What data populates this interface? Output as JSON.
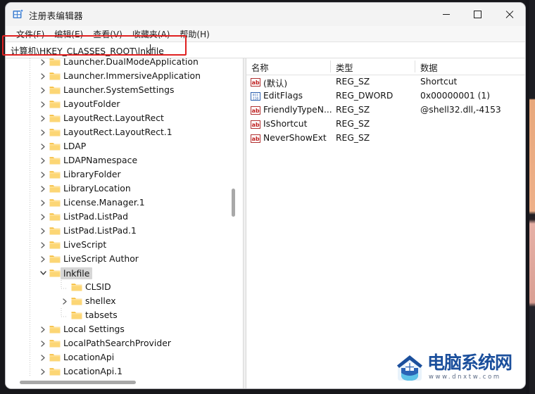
{
  "window": {
    "title": "注册表编辑器",
    "app_icon": "registry-editor-icon",
    "controls": {
      "minimize": "最小化",
      "maximize": "最大化",
      "close": "关闭"
    }
  },
  "menubar": {
    "items": [
      {
        "label": "文件(F)"
      },
      {
        "label": "编辑(E)"
      },
      {
        "label": "查看(V)"
      },
      {
        "label": "收藏夹(A)"
      },
      {
        "label": "帮助(H)"
      }
    ]
  },
  "address_bar": {
    "value": "计算机\\HKEY_CLASSES_ROOT\\lnkfile",
    "placeholder": "计算机\\",
    "highlighted": true,
    "highlight_color": "#e02020"
  },
  "tree": {
    "items": [
      {
        "label": "Launcher.DualModeApplication",
        "indent": 0,
        "expandable": true,
        "expanded": false,
        "selected": false
      },
      {
        "label": "Launcher.ImmersiveApplication",
        "indent": 0,
        "expandable": true,
        "expanded": false,
        "selected": false
      },
      {
        "label": "Launcher.SystemSettings",
        "indent": 0,
        "expandable": true,
        "expanded": false,
        "selected": false
      },
      {
        "label": "LayoutFolder",
        "indent": 0,
        "expandable": true,
        "expanded": false,
        "selected": false
      },
      {
        "label": "LayoutRect.LayoutRect",
        "indent": 0,
        "expandable": true,
        "expanded": false,
        "selected": false
      },
      {
        "label": "LayoutRect.LayoutRect.1",
        "indent": 0,
        "expandable": true,
        "expanded": false,
        "selected": false
      },
      {
        "label": "LDAP",
        "indent": 0,
        "expandable": true,
        "expanded": false,
        "selected": false
      },
      {
        "label": "LDAPNamespace",
        "indent": 0,
        "expandable": true,
        "expanded": false,
        "selected": false
      },
      {
        "label": "LibraryFolder",
        "indent": 0,
        "expandable": true,
        "expanded": false,
        "selected": false
      },
      {
        "label": "LibraryLocation",
        "indent": 0,
        "expandable": true,
        "expanded": false,
        "selected": false
      },
      {
        "label": "License.Manager.1",
        "indent": 0,
        "expandable": true,
        "expanded": false,
        "selected": false
      },
      {
        "label": "ListPad.ListPad",
        "indent": 0,
        "expandable": true,
        "expanded": false,
        "selected": false
      },
      {
        "label": "ListPad.ListPad.1",
        "indent": 0,
        "expandable": true,
        "expanded": false,
        "selected": false
      },
      {
        "label": "LiveScript",
        "indent": 0,
        "expandable": true,
        "expanded": false,
        "selected": false
      },
      {
        "label": "LiveScript Author",
        "indent": 0,
        "expandable": true,
        "expanded": false,
        "selected": false
      },
      {
        "label": "lnkfile",
        "indent": 0,
        "expandable": true,
        "expanded": true,
        "selected": true
      },
      {
        "label": "CLSID",
        "indent": 1,
        "expandable": false,
        "expanded": false,
        "selected": false
      },
      {
        "label": "shellex",
        "indent": 1,
        "expandable": true,
        "expanded": false,
        "selected": false
      },
      {
        "label": "tabsets",
        "indent": 1,
        "expandable": false,
        "expanded": false,
        "selected": false
      },
      {
        "label": "Local Settings",
        "indent": 0,
        "expandable": true,
        "expanded": false,
        "selected": false
      },
      {
        "label": "LocalPathSearchProvider",
        "indent": 0,
        "expandable": true,
        "expanded": false,
        "selected": false
      },
      {
        "label": "LocationApi",
        "indent": 0,
        "expandable": true,
        "expanded": false,
        "selected": false
      },
      {
        "label": "LocationApi.1",
        "indent": 0,
        "expandable": true,
        "expanded": false,
        "selected": false
      }
    ]
  },
  "values_list": {
    "columns": [
      {
        "label": "名称"
      },
      {
        "label": "类型"
      },
      {
        "label": "数据"
      }
    ],
    "rows": [
      {
        "icon": "string-value-icon",
        "name": "(默认)",
        "type": "REG_SZ",
        "data": "Shortcut"
      },
      {
        "icon": "dword-value-icon",
        "name": "EditFlags",
        "type": "REG_DWORD",
        "data": "0x00000001 (1)"
      },
      {
        "icon": "string-value-icon",
        "name": "FriendlyTypeN...",
        "type": "REG_SZ",
        "data": "@shell32.dll,-4153"
      },
      {
        "icon": "string-value-icon",
        "name": "IsShortcut",
        "type": "REG_SZ",
        "data": ""
      },
      {
        "icon": "string-value-icon",
        "name": "NeverShowExt",
        "type": "REG_SZ",
        "data": ""
      }
    ]
  },
  "watermark": {
    "name": "电脑系统网",
    "url": "www.dnxtw.com"
  }
}
